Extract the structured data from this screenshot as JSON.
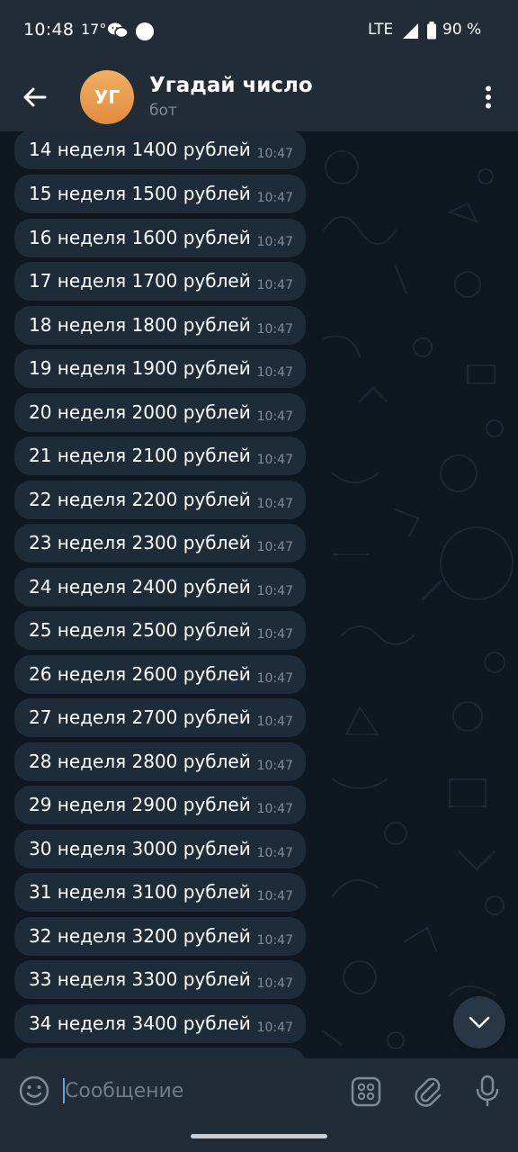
{
  "status_bar": {
    "time": "10:48",
    "temperature": "17°",
    "network": "LTE",
    "battery": "90 %"
  },
  "header": {
    "avatar_initials": "УГ",
    "title": "Угадай число",
    "subtitle": "бот"
  },
  "messages": [
    {
      "text": "14 неделя 1400 рублей",
      "time": "10:47"
    },
    {
      "text": "15 неделя 1500 рублей",
      "time": "10:47"
    },
    {
      "text": "16 неделя 1600 рублей",
      "time": "10:47"
    },
    {
      "text": "17 неделя 1700 рублей",
      "time": "10:47"
    },
    {
      "text": "18 неделя 1800 рублей",
      "time": "10:47"
    },
    {
      "text": "19 неделя 1900 рублей",
      "time": "10:47"
    },
    {
      "text": "20 неделя 2000 рублей",
      "time": "10:47"
    },
    {
      "text": "21 неделя 2100 рублей",
      "time": "10:47"
    },
    {
      "text": "22 неделя 2200 рублей",
      "time": "10:47"
    },
    {
      "text": "23 неделя 2300 рублей",
      "time": "10:47"
    },
    {
      "text": "24 неделя 2400 рублей",
      "time": "10:47"
    },
    {
      "text": "25 неделя 2500 рублей",
      "time": "10:47"
    },
    {
      "text": "26 неделя 2600 рублей",
      "time": "10:47"
    },
    {
      "text": "27 неделя 2700 рублей",
      "time": "10:47"
    },
    {
      "text": "28 неделя 2800 рублей",
      "time": "10:47"
    },
    {
      "text": "29 неделя 2900 рублей",
      "time": "10:47"
    },
    {
      "text": "30 неделя 3000 рублей",
      "time": "10:47"
    },
    {
      "text": "31 неделя 3100 рублей",
      "time": "10:47"
    },
    {
      "text": "32 неделя 3200 рублей",
      "time": "10:47"
    },
    {
      "text": "33 неделя 3300 рублей",
      "time": "10:47"
    },
    {
      "text": "34 неделя 3400 рублей",
      "time": "10:47"
    }
  ],
  "input": {
    "placeholder": "Сообщение",
    "value": ""
  },
  "icons": {
    "back": "arrow-back-icon",
    "menu": "more-vertical-icon",
    "scroll_down": "chevron-down-icon",
    "emoji": "smile-icon",
    "bot_commands": "grid-icon",
    "attach": "paperclip-icon",
    "mic": "microphone-icon"
  },
  "colors": {
    "accent": "#5ea4e8",
    "bubble": "#1e2c3a",
    "avatar": "#e89a48"
  }
}
